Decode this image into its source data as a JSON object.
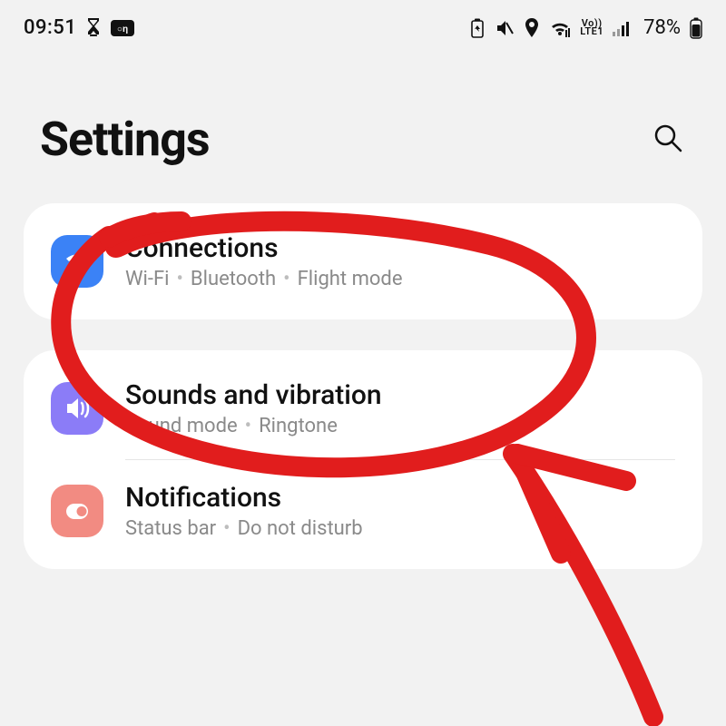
{
  "status_bar": {
    "time": "09:51",
    "battery_percent": "78%",
    "network_label_top": "Vo))",
    "network_label_bottom": "LTE1"
  },
  "header": {
    "title": "Settings"
  },
  "rows": {
    "connections": {
      "title": "Connections",
      "sub1": "Wi-Fi",
      "sub2": "Bluetooth",
      "sub3": "Flight mode"
    },
    "sounds": {
      "title": "Sounds and vibration",
      "sub1": "Sound mode",
      "sub2": "Ringtone"
    },
    "notifications": {
      "title": "Notifications",
      "sub1": "Status bar",
      "sub2": "Do not disturb"
    }
  },
  "annotation": {
    "color": "#e11d1d"
  }
}
